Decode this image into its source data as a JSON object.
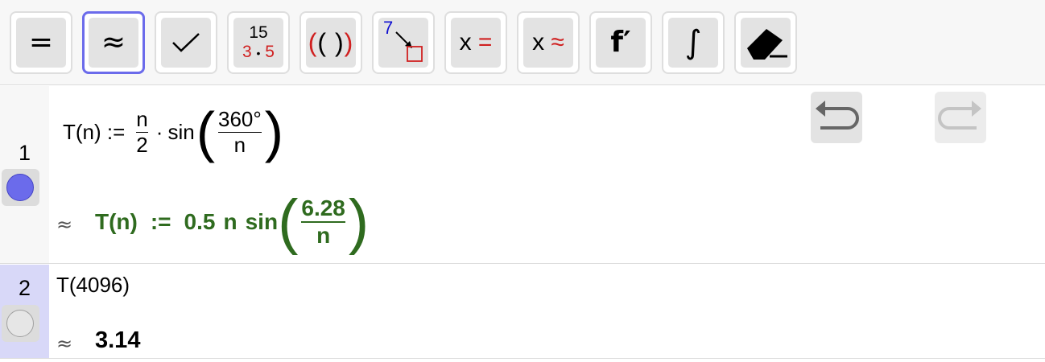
{
  "toolbar": {
    "buttons": [
      {
        "name": "evaluate",
        "glyph": "="
      },
      {
        "name": "numeric",
        "glyph": "≈",
        "active": true
      },
      {
        "name": "keep-input",
        "glyph": "✓"
      },
      {
        "name": "factor",
        "top": "15",
        "bottom_left": "3",
        "dot": "•",
        "bottom_right": "5"
      },
      {
        "name": "expand",
        "glyph": "( ( ) )"
      },
      {
        "name": "substitute",
        "digit": "7"
      },
      {
        "name": "solve",
        "x": "x",
        "sym": "="
      },
      {
        "name": "solve-numerically",
        "x": "x",
        "sym": "≈"
      },
      {
        "name": "derivative",
        "glyph": "f′"
      },
      {
        "name": "integral",
        "glyph": "∫"
      },
      {
        "name": "delete",
        "glyph": "eraser"
      }
    ]
  },
  "rows": [
    {
      "number": "1",
      "input": {
        "lhs": "T(n) :=",
        "frac1_num": "n",
        "frac1_den": "2",
        "dot": "·",
        "func": "sin",
        "frac2_num": "360°",
        "frac2_den": "n"
      },
      "output": {
        "approx": "≈",
        "lhs": "T(n)",
        "assign": ":=",
        "coef": "0.5",
        "var": "n",
        "func": "sin",
        "frac_num": "6.28",
        "frac_den": "n"
      },
      "visible": true
    },
    {
      "number": "2",
      "input": "T(4096)",
      "output": {
        "approx": "≈",
        "value": "3.14"
      },
      "visible": false
    }
  ],
  "colors": {
    "accent": "#6b6beb",
    "output_green": "#2f6b1f",
    "red": "#d02020",
    "blue": "#1010d0",
    "row_highlight": "#d8d8f8"
  }
}
